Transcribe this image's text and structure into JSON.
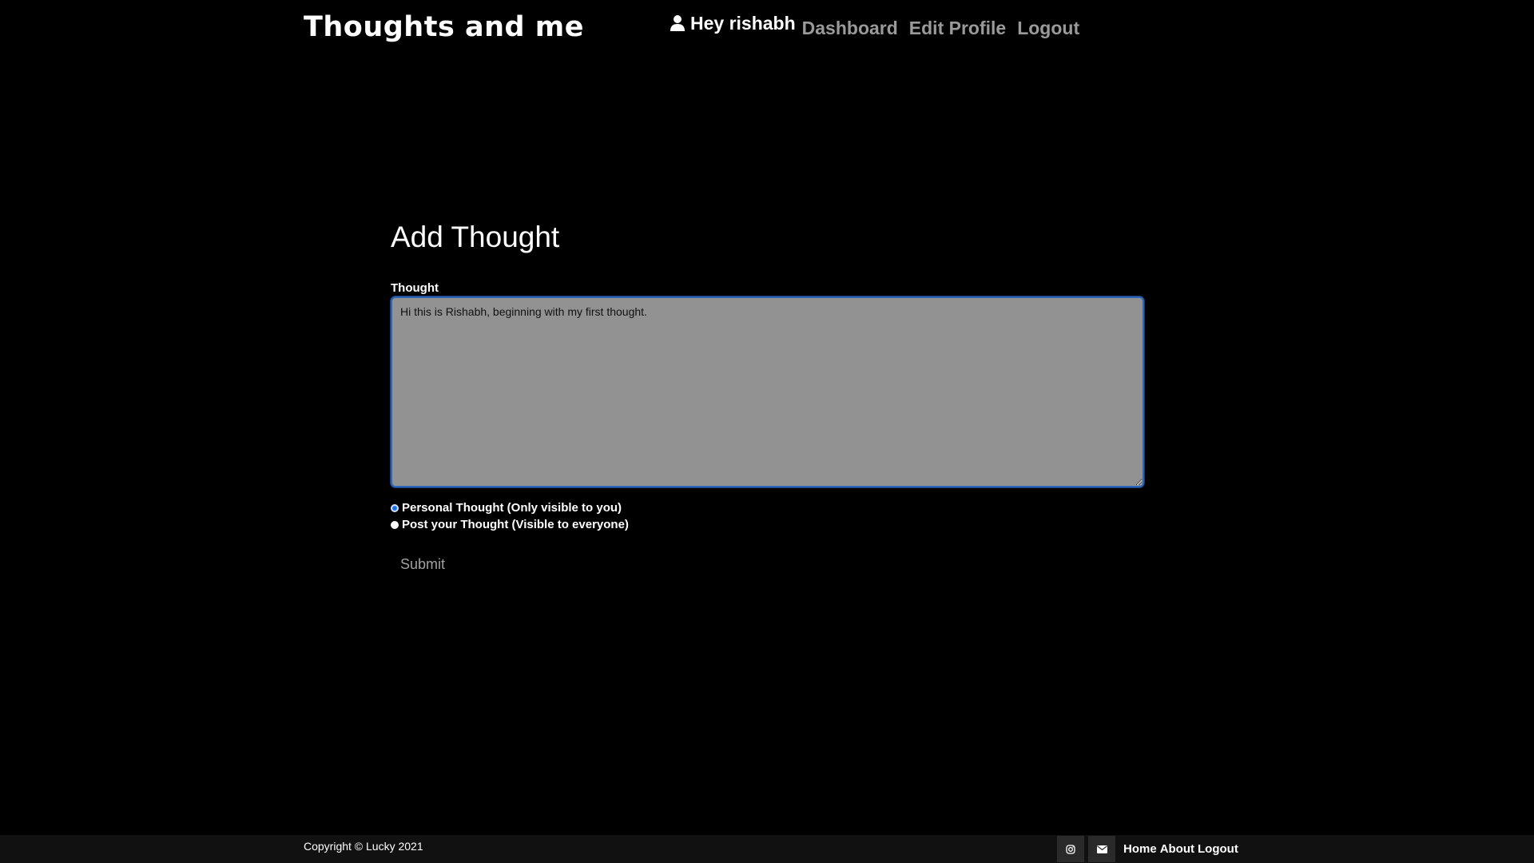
{
  "header": {
    "brand": "Thoughts and me",
    "greeting": "Hey rishabh",
    "nav": {
      "dashboard": "Dashboard",
      "edit_profile": "Edit Profile",
      "logout": "Logout"
    }
  },
  "form": {
    "title": "Add Thought",
    "thought_label": "Thought",
    "thought_value": "Hi this is Rishabh, beginning with my first thought.",
    "options": {
      "personal": "Personal Thought (Only visible to you)",
      "public": "Post your Thought (Visible to everyone)",
      "selected": "personal"
    },
    "submit_label": "Submit"
  },
  "footer": {
    "copyright": "Copyright © Lucky 2021",
    "icons": [
      "instagram-icon",
      "mail-icon"
    ],
    "links": {
      "home": "Home",
      "about": "About",
      "logout": "Logout"
    }
  },
  "colors": {
    "background": "#000000",
    "textarea_bg": "#929292",
    "focus_border": "#2b66b8",
    "muted_link": "#9a9a9a"
  }
}
